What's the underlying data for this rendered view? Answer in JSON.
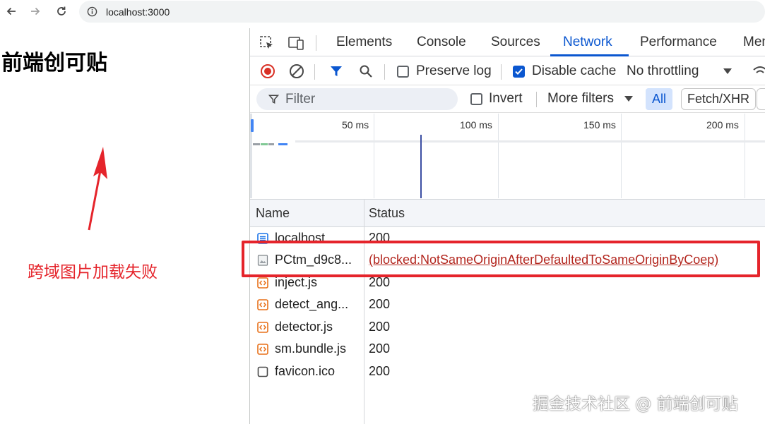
{
  "browser": {
    "url": "localhost:3000"
  },
  "page": {
    "title": "前端创可贴",
    "annotation": "跨域图片加载失败"
  },
  "devtools": {
    "tabs": [
      {
        "label": "Elements",
        "active": false
      },
      {
        "label": "Console",
        "active": false
      },
      {
        "label": "Sources",
        "active": false
      },
      {
        "label": "Network",
        "active": true
      },
      {
        "label": "Performance",
        "active": false
      },
      {
        "label": "Mem",
        "active": false
      }
    ],
    "toolbar": {
      "preserve_log_label": "Preserve log",
      "preserve_log_checked": false,
      "disable_cache_label": "Disable cache",
      "disable_cache_checked": true,
      "throttling": "No throttling"
    },
    "filterbar": {
      "filter_placeholder": "Filter",
      "invert_label": "Invert",
      "invert_checked": false,
      "more_filters_label": "More filters",
      "all_label": "All",
      "fetch_xhr_label": "Fetch/XHR"
    },
    "timeline": {
      "ticks": [
        "50 ms",
        "100 ms",
        "150 ms",
        "200 ms"
      ]
    },
    "table": {
      "columns": [
        "Name",
        "Status"
      ],
      "rows": [
        {
          "name": "localhost",
          "status": "200",
          "icon": "document-icon"
        },
        {
          "name": "PCtm_d9c8...",
          "status": "(blocked:NotSameOriginAfterDefaultedToSameOriginByCoep)",
          "icon": "image-icon",
          "error": true
        },
        {
          "name": "inject.js",
          "status": "200",
          "icon": "script-icon"
        },
        {
          "name": "detect_ang...",
          "status": "200",
          "icon": "script-icon"
        },
        {
          "name": "detector.js",
          "status": "200",
          "icon": "script-icon"
        },
        {
          "name": "sm.bundle.js",
          "status": "200",
          "icon": "script-icon"
        },
        {
          "name": "favicon.ico",
          "status": "200",
          "icon": "blank-file-icon"
        }
      ]
    }
  },
  "watermark": "掘金技术社区 @ 前端创可贴",
  "colors": {
    "accent": "#0b57d0",
    "annotation_red": "#e5242b",
    "record_red": "#d93025",
    "script_orange": "#e8711a"
  }
}
